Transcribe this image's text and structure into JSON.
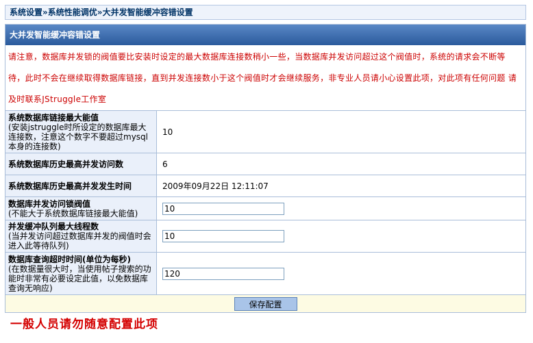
{
  "breadcrumb": {
    "item1": "系统设置",
    "sep1": "»",
    "item2": "系统性能调优",
    "sep2": "»",
    "item3": "大并发智能缓冲容错设置"
  },
  "panel": {
    "title": "大并发智能缓冲容错设置",
    "notice": "请注意，数据库并发锁的阀值要比安装时设定的最大数据库连接数稍小一些，当数据库并发访问超过这个阀值时，系统的请求会不断等待，此时不会在继续取得数据库链接，直到并发连接数小于这个阀值时才会继续服务，非专业人员请小心设置此项，对此项有任何问题 请及时联系JStruggle工作室"
  },
  "rows": [
    {
      "label": "系统数据库链接最大能值",
      "hint": "(安装jstruggle时所设定的数据库最大连接数，注意这个数字不要超过mysql本身的连接数)",
      "value": "10"
    },
    {
      "label": "系统数据库历史最高并发访问数",
      "hint": "",
      "value": "6"
    },
    {
      "label": "系统数据库历史最高并发发生时间",
      "hint": "",
      "value": "2009年09月22日 12:11:07"
    },
    {
      "label": "数据库并发访问锁阀值",
      "hint": "(不能大于系统数据库链接最大能值)",
      "value": "10"
    },
    {
      "label": "并发缓冲队列最大线程数",
      "hint": "(当并发访问超过数据库并发的阀值时会进入此等待队列)",
      "value": "10"
    },
    {
      "label": "数据库查询超时时间(单位为每秒)",
      "hint": "(在数据量很大时，当使用帖子搜索的功能时非常有必要设定此值，以免数据库查询无响应)",
      "value": "120"
    }
  ],
  "save_label": "保存配置",
  "warning": "一般人员请勿随意配置此项"
}
